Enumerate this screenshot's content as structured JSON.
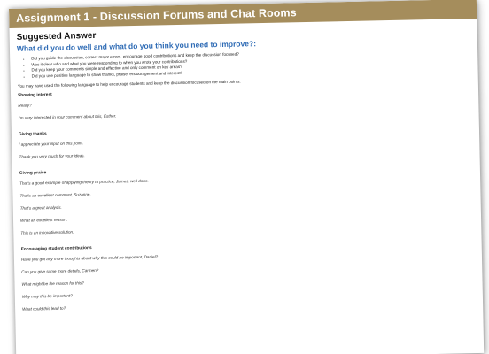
{
  "header": {
    "title": "Assignment 1 - Discussion Forums and Chat Rooms"
  },
  "answer": {
    "heading": "Suggested Answer",
    "question": "What did you do well and what do you think you need to improve?:",
    "bullets": [
      "Did you guide the discussion, correct major errors, encourage good contributions and keep the discussion focused?",
      "Was it clear who and what you were responding to when you wrote your contributions?",
      "Did you keep your comments simple and effective and only comment on key areas?",
      "Did you use positive language to show thanks, praise, encouragement and interest?"
    ],
    "intro": "You may have used the following language to help encourage students and keep the discussion focused on the main points:"
  },
  "sections": [
    {
      "title": "Showing interest",
      "phrases": [
        "Really?",
        "I'm very interested in your comment about this, Esther."
      ]
    },
    {
      "title": "Giving thanks",
      "phrases": [
        "I appreciate your input on this point.",
        "Thank you very much for your ideas."
      ]
    },
    {
      "title": "Giving praise",
      "phrases": [
        "That's a good example of applying theory to practice, James, well done.",
        "That's an excellent comment, Suzanne.",
        "That's a great analysis.",
        "What an excellent reason.",
        "This is an innovative solution."
      ]
    },
    {
      "title": "Encouraging student contributions",
      "phrases": [
        "Have you got any more thoughts about why this could be important, Daniel?",
        "Can you give some more details, Carmen?",
        "What might be the reason for this?",
        "Why may this be important?",
        "What could this lead to?"
      ]
    }
  ],
  "colors": {
    "title_bar": "#a58d5c",
    "question_text": "#2e6bb5"
  }
}
